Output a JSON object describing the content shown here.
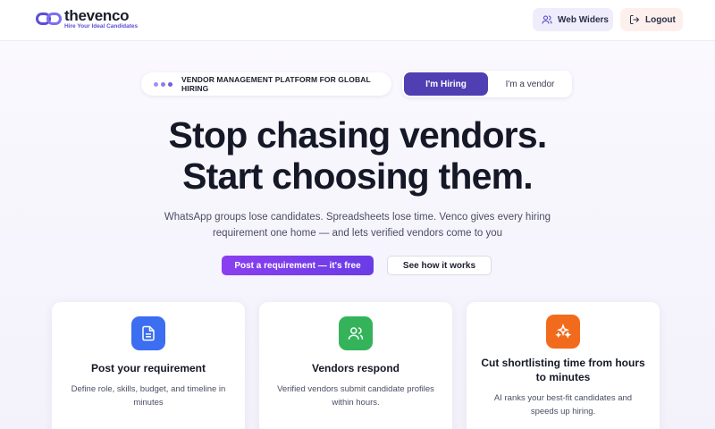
{
  "header": {
    "logo_name": "thevenco",
    "logo_tagline": "Hire Your Ideal Candidates",
    "user_button": "Web Widers",
    "logout_button": "Logout"
  },
  "pill": {
    "text": "VENDOR MANAGEMENT PLATFORM FOR GLOBAL HIRING",
    "dot_colors": [
      "#a78bfa",
      "#8b7cf0",
      "#6d5fe0"
    ]
  },
  "toggle": {
    "active": "I'm Hiring",
    "inactive": "I'm a vendor"
  },
  "hero": {
    "title_line1": "Stop chasing vendors.",
    "title_line2": "Start choosing them.",
    "subtitle_line1": "WhatsApp groups lose candidates. Spreadsheets lose time. Venco gives every hiring",
    "subtitle_line2": "requirement one home — and lets verified vendors come to you"
  },
  "cta": {
    "primary": "Post a requirement — it's free",
    "secondary": "See how it works"
  },
  "cards": [
    {
      "icon": "document-icon",
      "color": "#3b6ef0",
      "title": "Post your requirement",
      "desc_line1": "Define role, skills, budget, and timeline in",
      "desc_line2": "minutes"
    },
    {
      "icon": "users-icon",
      "color": "#34b35a",
      "title": "Vendors respond",
      "desc_line1": "Verified vendors submit candidate profiles",
      "desc_line2": "within hours."
    },
    {
      "icon": "sparkle-icon",
      "color": "#f26b1d",
      "title_line1": "Cut shortlisting time from hours",
      "title_line2": "to minutes",
      "desc_line1": "AI ranks your best-fit candidates and",
      "desc_line2": "speeds up hiring."
    }
  ],
  "colors": {
    "brand": "#5b4fd6",
    "toggle_active": "#4f3fb3",
    "cta_gradient_start": "#8a3ff0",
    "cta_gradient_end": "#6a3ce6"
  }
}
